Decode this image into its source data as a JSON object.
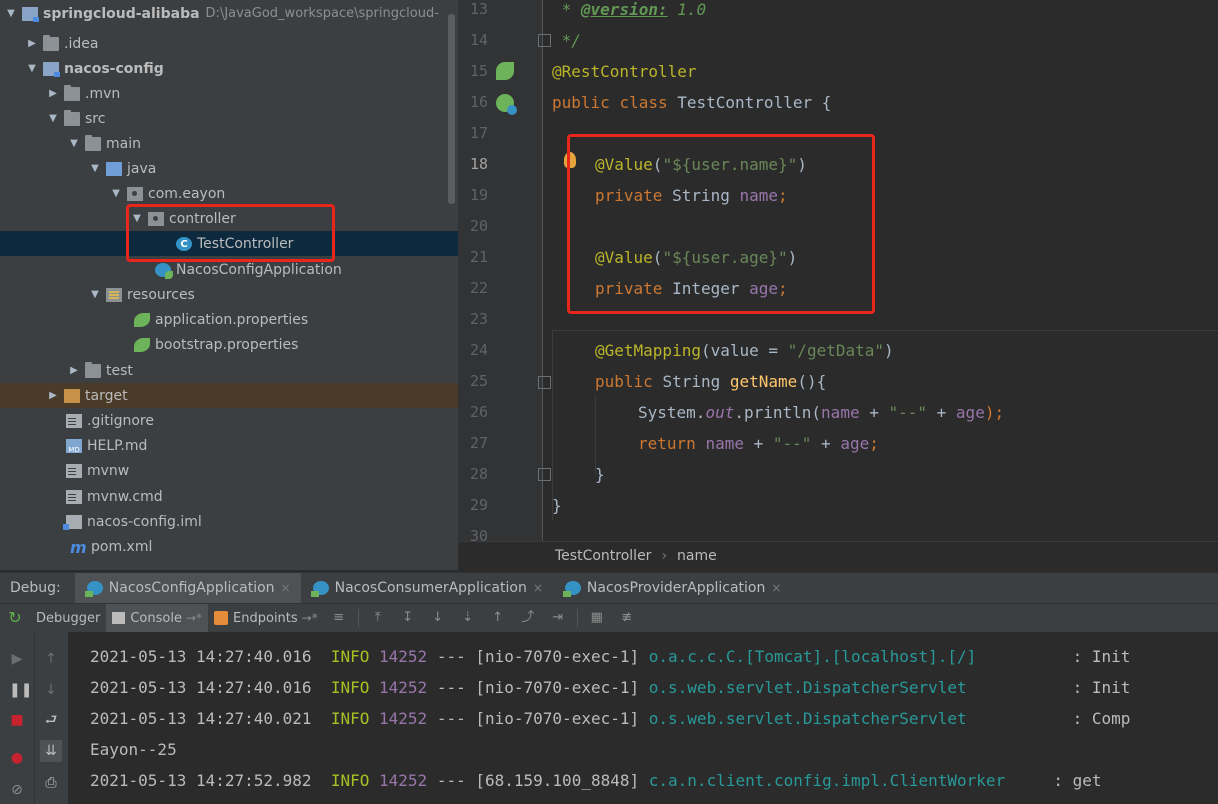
{
  "project_tree": {
    "rows": [
      {
        "label": "springcloud-alibaba",
        "path": "D:\\JavaGod_workspace\\springcloud-"
      },
      {
        "label": ".idea"
      },
      {
        "label": "nacos-config"
      },
      {
        "label": ".mvn"
      },
      {
        "label": "src"
      },
      {
        "label": "main"
      },
      {
        "label": "java"
      },
      {
        "label": "com.eayon"
      },
      {
        "label": "controller"
      },
      {
        "label": "TestController"
      },
      {
        "label": "NacosConfigApplication"
      },
      {
        "label": "resources"
      },
      {
        "label": "application.properties"
      },
      {
        "label": "bootstrap.properties"
      },
      {
        "label": "test"
      },
      {
        "label": "target"
      },
      {
        "label": ".gitignore"
      },
      {
        "label": "HELP.md"
      },
      {
        "label": "mvnw"
      },
      {
        "label": "mvnw.cmd"
      },
      {
        "label": "nacos-config.iml"
      },
      {
        "label": "pom.xml"
      }
    ],
    "md_icon_text": "MD",
    "maven_icon_text": "m"
  },
  "editor": {
    "line_numbers": [
      "13",
      "14",
      "15",
      "16",
      "17",
      "18",
      "19",
      "20",
      "21",
      "22",
      "23",
      "24",
      "25",
      "26",
      "27",
      "28",
      "29",
      "30"
    ],
    "code": {
      "l13_a": " * ",
      "l13_tag": "@version:",
      "l13_b": " 1.0",
      "l14": " */",
      "l15": "@RestController",
      "l16_kw1": "public ",
      "l16_kw2": "class ",
      "l16_name": "TestController {",
      "l18_ann": "@Value",
      "l18_p1": "(",
      "l18_str": "\"${user.name}\"",
      "l18_p2": ")",
      "l19_kw": "private ",
      "l19_type": "String ",
      "l19_field": "name",
      "l19_semi": ";",
      "l21_ann": "@Value",
      "l21_p1": "(",
      "l21_str": "\"${user.age}\"",
      "l21_p2": ")",
      "l22_kw": "private ",
      "l22_type": "Integer ",
      "l22_field": "age",
      "l22_semi": ";",
      "l24_ann": "@GetMapping",
      "l24_p1": "(value = ",
      "l24_str": "\"/getData\"",
      "l24_p2": ")",
      "l25_kw": "public ",
      "l25_type": "String ",
      "l25_fn": "getName",
      "l25_rest": "(){",
      "l26_a": "System.",
      "l26_out": "out",
      "l26_b": ".println(",
      "l26_f1": "name",
      "l26_c": " + ",
      "l26_str": "\"--\"",
      "l26_d": " + ",
      "l26_f2": "age",
      "l26_e": ");",
      "l27_kw": "return ",
      "l27_f1": "name",
      "l27_c": " + ",
      "l27_str": "\"--\"",
      "l27_d": " + ",
      "l27_f2": "age",
      "l27_e": ";",
      "l28": "}",
      "l29": "}"
    },
    "breadcrumb": [
      "TestController",
      "name"
    ],
    "breadcrumb_sep": "›"
  },
  "debug": {
    "label": "Debug:",
    "tabs": [
      "NacosConfigApplication",
      "NacosConsumerApplication",
      "NacosProviderApplication"
    ],
    "tab_close": "×",
    "toolbar": {
      "debugger": "Debugger",
      "console": "Console",
      "endpoints": "Endpoints",
      "pin": "→*"
    },
    "log": [
      {
        "ts": "2021-05-13 14:27:40.016",
        "level": "INFO",
        "pid": "14252",
        "sep": "---",
        "thread": "[nio-7070-exec-1]",
        "logger": "o.a.c.c.C.[Tomcat].[localhost].[/]",
        "msg": ": Init"
      },
      {
        "ts": "2021-05-13 14:27:40.016",
        "level": "INFO",
        "pid": "14252",
        "sep": "---",
        "thread": "[nio-7070-exec-1]",
        "logger": "o.s.web.servlet.DispatcherServlet",
        "msg": ": Init"
      },
      {
        "ts": "2021-05-13 14:27:40.021",
        "level": "INFO",
        "pid": "14252",
        "sep": "---",
        "thread": "[nio-7070-exec-1]",
        "logger": "o.s.web.servlet.DispatcherServlet",
        "msg": ": Comp"
      },
      {
        "plain": "Eayon--25"
      },
      {
        "ts": "2021-05-13 14:27:52.982",
        "level": "INFO",
        "pid": "14252",
        "sep": "---",
        "thread": "[68.159.100_8848]",
        "logger": "c.a.n.client.config.impl.ClientWorker",
        "msg": ": get"
      }
    ]
  },
  "colors": {
    "annotation_box": "#e8261c",
    "selection": "#0d293e",
    "keyword": "#cc7832",
    "string": "#6a8759",
    "field": "#9876aa"
  },
  "icons": [
    "expand-arrow-icon",
    "folder-icon",
    "module-icon",
    "package-icon",
    "class-icon",
    "spring-leaf-icon",
    "file-icon",
    "maven-icon",
    "rerun-icon",
    "pause-icon",
    "stop-icon",
    "scroll-to-end-icon",
    "print-icon"
  ]
}
